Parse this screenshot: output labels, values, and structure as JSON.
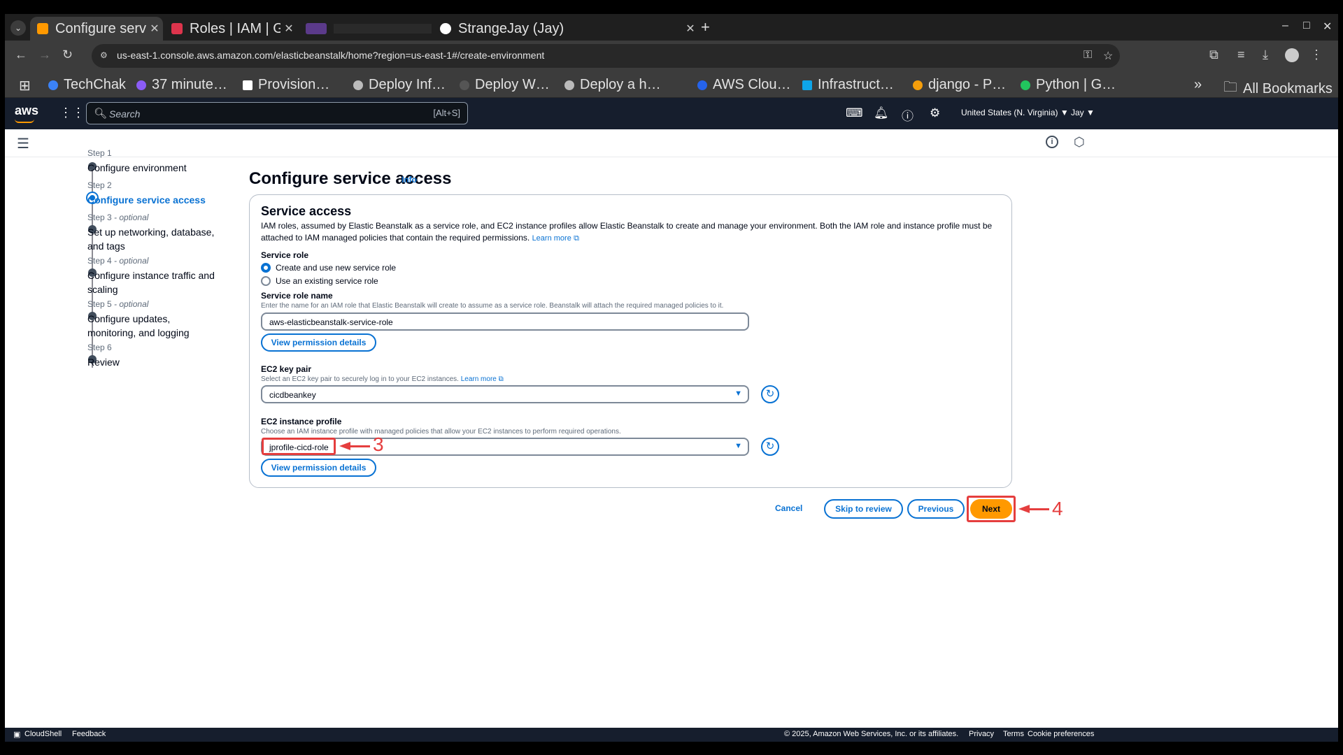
{
  "browser": {
    "tabs": [
      {
        "title": "Configure service a",
        "favicon_color": "#ff9900"
      },
      {
        "title": "Roles | IAM | Global",
        "favicon_color": "#dd344c"
      },
      {
        "title": "",
        "favicon_color": "#5b3a8a"
      },
      {
        "title": "StrangeJay (Jay)",
        "favicon_color": "#ffffff"
      }
    ],
    "url": "us-east-1.console.aws.amazon.com/elasticbeanstalk/home?region=us-east-1#/create-environment",
    "bookmarks": [
      {
        "label": "TechChak",
        "color": "#3b82f6"
      },
      {
        "label": "37 minute…",
        "color": "#8b5cf6"
      },
      {
        "label": "Provision…",
        "color": "#ffffff"
      },
      {
        "label": "Deploy Inf…",
        "color": "#bbbbbb"
      },
      {
        "label": "Deploy W…",
        "color": "#444444"
      },
      {
        "label": "Deploy a h…",
        "color": "#bbbbbb"
      },
      {
        "label": "AWS Clou…",
        "color": "#2563eb"
      },
      {
        "label": "Infrastruct…",
        "color": "#0ea5e9"
      },
      {
        "label": "django - P…",
        "color": "#f59e0b"
      },
      {
        "label": "Python | G…",
        "color": "#22c55e"
      }
    ],
    "bookmarks_overflow": "»",
    "all_bookmarks": "All Bookmarks"
  },
  "aws_header": {
    "logo": "aws",
    "search_placeholder": "Search",
    "search_shortcut": "[Alt+S]",
    "region": "United States (N. Virginia) ▼",
    "user": "Jay ▼"
  },
  "steps": [
    {
      "num": "Step 1",
      "optional": "",
      "label": "Configure environment"
    },
    {
      "num": "Step 2",
      "optional": "",
      "label": "Configure service access"
    },
    {
      "num": "Step 3",
      "optional": "- optional",
      "label": "Set up networking, database, and tags"
    },
    {
      "num": "Step 4",
      "optional": "- optional",
      "label": "Configure instance traffic and scaling"
    },
    {
      "num": "Step 5",
      "optional": "- optional",
      "label": "Configure updates, monitoring, and logging"
    },
    {
      "num": "Step 6",
      "optional": "",
      "label": "Review"
    }
  ],
  "page": {
    "title": "Configure service access",
    "info": "Info"
  },
  "service_access": {
    "title": "Service access",
    "description": "IAM roles, assumed by Elastic Beanstalk as a service role, and EC2 instance profiles allow Elastic Beanstalk to create and manage your environment. Both the IAM role and instance profile must be attached to IAM managed policies that contain the required permissions.",
    "learn_more": "Learn more",
    "service_role_label": "Service role",
    "radio_new": "Create and use new service role",
    "radio_existing": "Use an existing service role",
    "role_name_label": "Service role name",
    "role_name_desc": "Enter the name for an IAM role that Elastic Beanstalk will create to assume as a service role. Beanstalk will attach the required managed policies to it.",
    "role_name_value": "aws-elasticbeanstalk-service-role",
    "view_permissions": "View permission details",
    "key_pair_label": "EC2 key pair",
    "key_pair_desc": "Select an EC2 key pair to securely log in to your EC2 instances.",
    "key_pair_learn_more": "Learn more",
    "key_pair_value": "cicdbeankey",
    "instance_profile_label": "EC2 instance profile",
    "instance_profile_desc": "Choose an IAM instance profile with managed policies that allow your EC2 instances to perform required operations.",
    "instance_profile_value": "jprofile-cicd-role",
    "view_permissions_2": "View permission details"
  },
  "actions": {
    "cancel": "Cancel",
    "skip": "Skip to review",
    "previous": "Previous",
    "next": "Next"
  },
  "annotations": {
    "num_3": "3",
    "num_4": "4",
    "color": "#e53e3e"
  },
  "footer": {
    "cloudshell": "CloudShell",
    "feedback": "Feedback",
    "copyright": "© 2025, Amazon Web Services, Inc. or its affiliates.",
    "privacy": "Privacy",
    "terms": "Terms",
    "cookies": "Cookie preferences"
  }
}
